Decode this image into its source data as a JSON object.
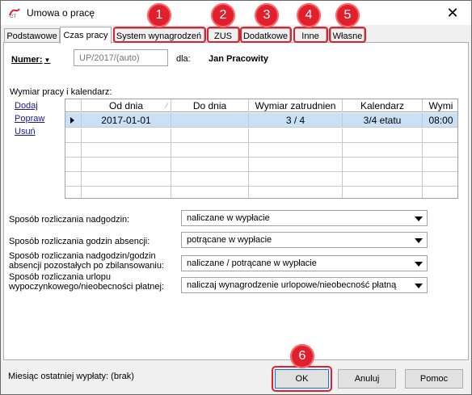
{
  "window": {
    "title": "Umowa o pracę",
    "close_glyph": "✕"
  },
  "tabs": [
    {
      "label": "Podstawowe",
      "active": false
    },
    {
      "label": "Czas pracy",
      "active": true
    },
    {
      "label": "System wynagrodzeń",
      "active": false,
      "badge": "1"
    },
    {
      "label": "ZUS",
      "active": false,
      "badge": "2"
    },
    {
      "label": "Dodatkowe",
      "active": false,
      "badge": "3"
    },
    {
      "label": "Inne",
      "active": false,
      "badge": "4"
    },
    {
      "label": "Własne",
      "active": false,
      "badge": "5"
    }
  ],
  "form": {
    "numer_label": "Numer:",
    "numer_dropdown_glyph": "▼",
    "numer_placeholder": "UP/2017/(auto)",
    "dla_label": "dla:",
    "employee_name": "Jan Pracowity",
    "section_label": "Wymiar pracy i kalendarz:"
  },
  "side_links": [
    "Dodaj",
    "Popraw",
    "Usuń"
  ],
  "grid": {
    "columns": [
      "Od dnia",
      "Do dnia",
      "Wymiar zatrudnien",
      "Kalendarz",
      "Wymi"
    ],
    "rows": [
      {
        "od_dnia": "2017-01-01",
        "do_dnia": "",
        "wymiar": "3 / 4",
        "kalendarz": "3/4 etatu",
        "wymi": "08:00",
        "selected": true
      }
    ]
  },
  "settings": [
    {
      "label": "Sposób rozliczania nadgodzin:",
      "value": "naliczane w wypłacie"
    },
    {
      "label": "Sposób rozliczania godzin absencji:",
      "value": "potrącane w wypłacie"
    },
    {
      "label": "Sposób rozliczania nadgodzin/godzin absencji pozostałych po zbilansowaniu:",
      "value": "naliczane / potrącane w wypłacie"
    },
    {
      "label": "Sposób rozliczania urlopu wypoczynkowego/nieobecności płatnej:",
      "value": "naliczaj wynagrodzenie urlopowe/nieobecność płatną"
    }
  ],
  "footer": {
    "last_payout_label": "Miesiąc ostatniej wypłaty: (brak)",
    "ok_label": "OK",
    "ok_badge": "6",
    "cancel_label": "Anuluj",
    "help_label": "Pomoc"
  },
  "colors": {
    "annotation_red": "#e0202d",
    "selected_row": "#c9e1f7",
    "link": "#1a1a8c"
  }
}
